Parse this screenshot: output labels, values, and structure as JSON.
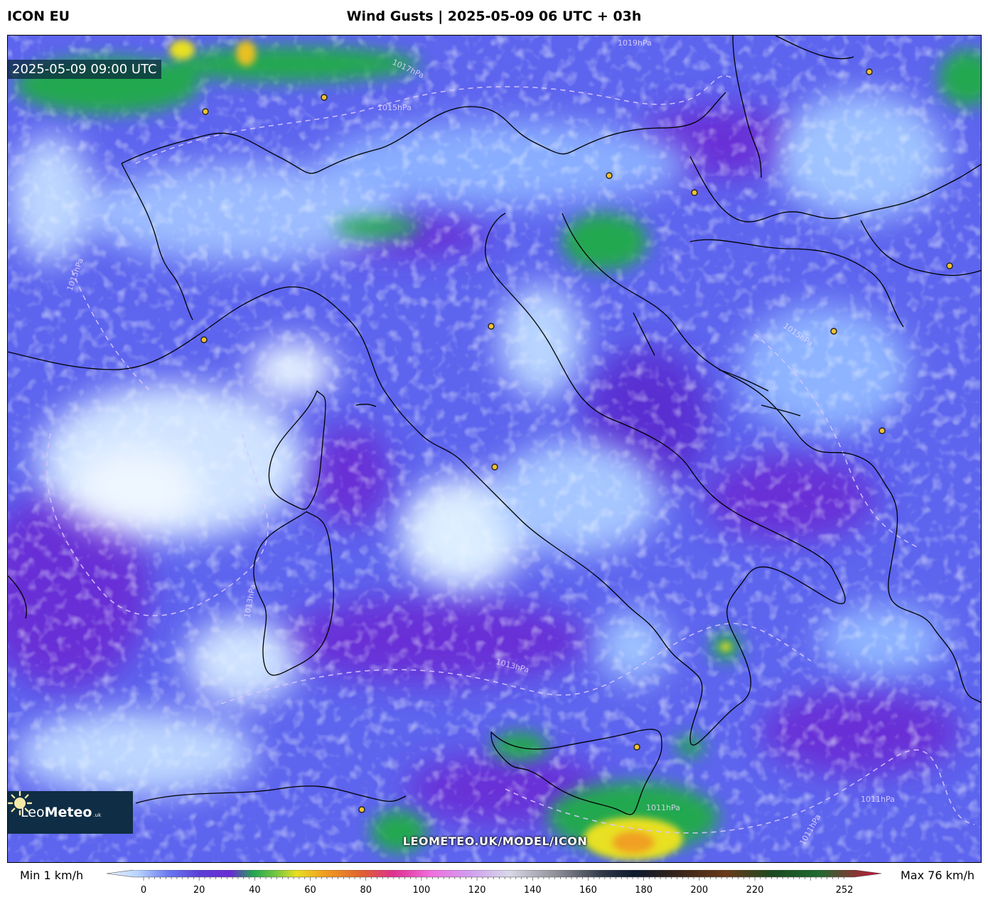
{
  "header": {
    "model": "ICON EU",
    "title": "Wind Gusts | 2025-05-09 06 UTC + 03h"
  },
  "map": {
    "valid_time": "2025-05-09 09:00 UTC",
    "isobar_labels": [
      "1019hPa",
      "1017hPa",
      "1015hPa",
      "1015hPa",
      "1013hPa",
      "1011hPa",
      "1011hPa",
      "1011hPa",
      "1015hPa",
      "1013hPa"
    ],
    "watermark": "LEOMETEO.UK/MODEL/ICON",
    "palette": {
      "calm": "#d8ecff",
      "light": "#8fb4ff",
      "moderate": "#5f6bf2",
      "fresh": "#6a2fd6",
      "strong": "#2aa64a",
      "gale": "#e8e020",
      "border": "#000000",
      "isobar": "#d8c8ff"
    }
  },
  "logo": {
    "name_light": "Leo",
    "name_bold": "Meteo",
    "suffix": ".uk"
  },
  "legend": {
    "min_label": "Min 1 km/h",
    "max_label": "Max 76 km/h",
    "tick_labels": [
      "0",
      "20",
      "40",
      "60",
      "80",
      "100",
      "120",
      "140",
      "160",
      "180",
      "200",
      "220",
      "252"
    ]
  }
}
